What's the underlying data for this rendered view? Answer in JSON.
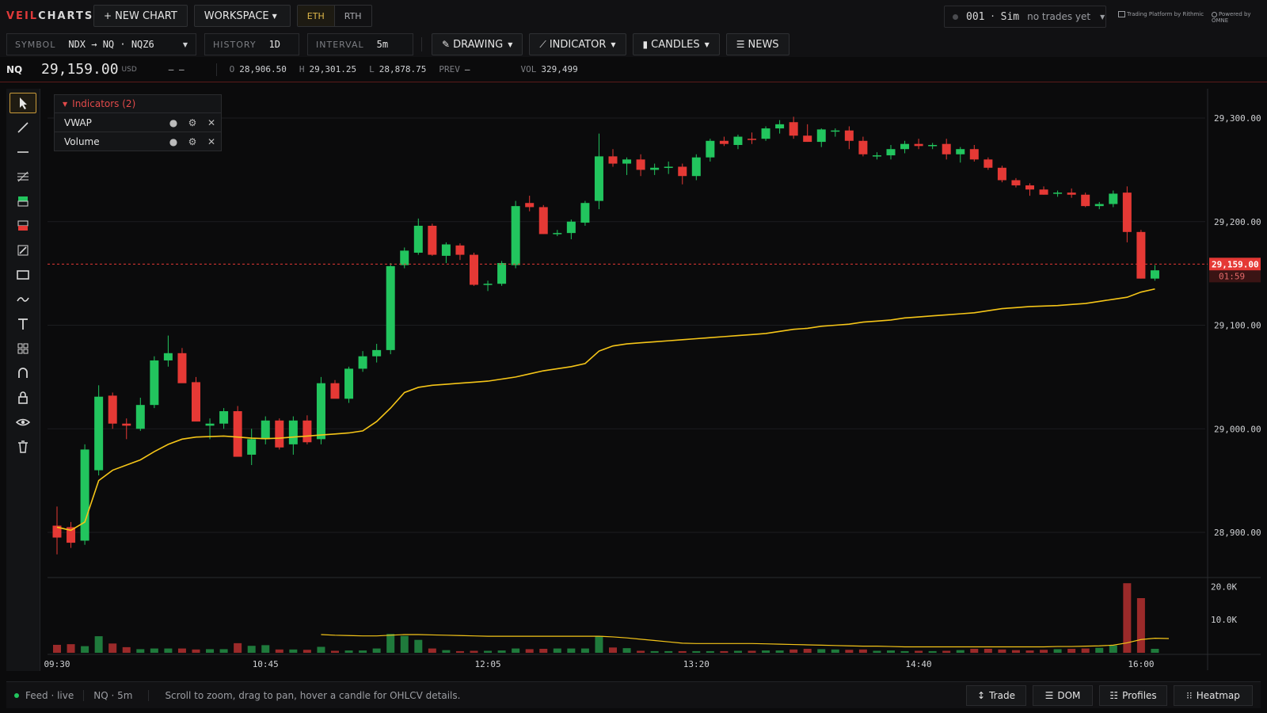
{
  "header": {
    "logo_a": "VEIL",
    "logo_b": "CHARTS",
    "new_chart": "NEW CHART",
    "workspace": "WORKSPACE",
    "session_eth": "ETH",
    "session_rth": "RTH",
    "account_id": "001",
    "account_sep": "·",
    "account_mode": "Sim",
    "account_status": "no trades yet",
    "platform_note": "Trading Platform by Rithmic",
    "powered_note": "Powered by OMNE"
  },
  "toolbar": {
    "symbol_label": "SYMBOL",
    "symbol_value": "NDX → NQ · NQZ6",
    "history_label": "HISTORY",
    "history_value": "1D",
    "interval_label": "INTERVAL",
    "interval_value": "5m",
    "drawing": "DRAWING",
    "indicator": "INDICATOR",
    "candles": "CANDLES",
    "news": "NEWS"
  },
  "quote": {
    "symbol": "NQ",
    "price": "29,159.00",
    "currency": "USD",
    "change": "– –",
    "o_label": "O",
    "o": "28,906.50",
    "h_label": "H",
    "h": "29,301.25",
    "l_label": "L",
    "l": "28,878.75",
    "prev_label": "PREV",
    "prev": "–",
    "vol_label": "VOL",
    "vol": "329,499"
  },
  "indicators": {
    "header": "Indicators (2)",
    "items": [
      {
        "name": "VWAP"
      },
      {
        "name": "Volume"
      }
    ]
  },
  "price_axis": {
    "ticks": [
      "29,300.00",
      "29,200.00",
      "29,100.00",
      "29,000.00",
      "28,900.00"
    ],
    "last_price": "29,159.00",
    "countdown": "01:59"
  },
  "volume_axis": {
    "ticks": [
      "20.0K",
      "10.0K"
    ]
  },
  "time_axis": {
    "ticks": [
      "09:30",
      "10:45",
      "12:05",
      "13:20",
      "14:40",
      "16:00"
    ]
  },
  "colors": {
    "up": "#22c55e",
    "down": "#e53935",
    "vwap": "#f5c518",
    "accent": "#e03a3a"
  },
  "statusbar": {
    "feed": "Feed · live",
    "chart": "NQ · 5m",
    "hint": "Scroll to zoom, drag to pan, hover a candle for OHLCV details.",
    "trade": "Trade",
    "dom": "DOM",
    "profiles": "Profiles",
    "heatmap": "Heatmap"
  },
  "chart_data": {
    "type": "candlestick",
    "x_start": "09:30",
    "interval_minutes": 5,
    "ylim": [
      28860,
      29320
    ],
    "volume_ylim": [
      0,
      22000
    ],
    "candles": [
      [
        28906.5,
        28925,
        28878.75,
        28895,
        2400
      ],
      [
        28905,
        28910,
        28885,
        28890,
        2600
      ],
      [
        28892,
        28985,
        28888,
        28980,
        2000
      ],
      [
        28960,
        29042,
        28955,
        29031,
        5000
      ],
      [
        29032,
        29035,
        29000,
        29005,
        2800
      ],
      [
        29005,
        29010,
        28990,
        29003,
        1700
      ],
      [
        29000,
        29030,
        28998,
        29023,
        1100
      ],
      [
        29023,
        29070,
        29020,
        29066,
        1300
      ],
      [
        29066,
        29090,
        29060,
        29073,
        1300
      ],
      [
        29073,
        29078,
        29045,
        29044,
        1300
      ],
      [
        29045,
        29050,
        29008,
        29007,
        1000
      ],
      [
        29003,
        29010,
        28990,
        29005,
        1100
      ],
      [
        29005,
        29020,
        29000,
        29017,
        1100
      ],
      [
        29017,
        29022,
        28980,
        28973,
        2900
      ],
      [
        28975,
        29000,
        28965,
        28990,
        2100
      ],
      [
        28990,
        29012,
        28985,
        29008,
        2300
      ],
      [
        29008,
        29010,
        28980,
        28982,
        1000
      ],
      [
        28985,
        29012,
        28975,
        29008,
        1000
      ],
      [
        29008,
        29013,
        28985,
        28987,
        900
      ],
      [
        28990,
        29050,
        28985,
        29044,
        1800
      ],
      [
        29044,
        29047,
        29030,
        29029,
        600
      ],
      [
        29029,
        29060,
        29025,
        29058,
        700
      ],
      [
        29058,
        29075,
        29055,
        29070,
        700
      ],
      [
        29070,
        29082,
        29064,
        29076,
        1300
      ],
      [
        29076,
        29160,
        29072,
        29157,
        5700
      ],
      [
        29158,
        29175,
        29155,
        29172,
        5100
      ],
      [
        29170,
        29203,
        29168,
        29196,
        3900
      ],
      [
        29196,
        29198,
        29167,
        29168,
        1300
      ],
      [
        29167,
        29180,
        29160,
        29178,
        800
      ],
      [
        29177,
        29179,
        29163,
        29168,
        500
      ],
      [
        29168,
        29170,
        29138,
        29139,
        600
      ],
      [
        29140,
        29143,
        29133,
        29140,
        600
      ],
      [
        29140,
        29162,
        29138,
        29160,
        700
      ],
      [
        29158,
        29220,
        29155,
        29215,
        1300
      ],
      [
        29218,
        29225,
        29210,
        29214,
        1100
      ],
      [
        29214,
        29216,
        29188,
        29188,
        1200
      ],
      [
        29189,
        29192,
        29186,
        29189,
        1300
      ],
      [
        29189,
        29202,
        29183,
        29200,
        1300
      ],
      [
        29199,
        29220,
        29196,
        29218,
        1300
      ],
      [
        29220,
        29285,
        29212,
        29263,
        5000
      ],
      [
        29263,
        29270,
        29253,
        29256,
        1600
      ],
      [
        29256,
        29262,
        29245,
        29260,
        1400
      ],
      [
        29260,
        29265,
        29244,
        29250,
        600
      ],
      [
        29250,
        29256,
        29245,
        29252,
        500
      ],
      [
        29252,
        29258,
        29246,
        29253,
        500
      ],
      [
        29253,
        29256,
        29236,
        29244,
        500
      ],
      [
        29244,
        29265,
        29240,
        29262,
        500
      ],
      [
        29262,
        29280,
        29258,
        29278,
        500
      ],
      [
        29278,
        29282,
        29273,
        29275,
        500
      ],
      [
        29274,
        29284,
        29270,
        29282,
        600
      ],
      [
        29280,
        29286,
        29275,
        29279,
        600
      ],
      [
        29280,
        29292,
        29278,
        29290,
        700
      ],
      [
        29290,
        29298,
        29285,
        29294,
        700
      ],
      [
        29296,
        29301.25,
        29280,
        29283,
        1000
      ],
      [
        29283,
        29294,
        29277,
        29277,
        1200
      ],
      [
        29277,
        29290,
        29272,
        29289,
        1100
      ],
      [
        29287,
        29290,
        29282,
        29288,
        1000
      ],
      [
        29288,
        29292,
        29270,
        29278,
        900
      ],
      [
        29278,
        29282,
        29263,
        29265,
        1000
      ],
      [
        29264,
        29267,
        29260,
        29264,
        600
      ],
      [
        29264,
        29274,
        29260,
        29270,
        700
      ],
      [
        29270,
        29278,
        29266,
        29275,
        500
      ],
      [
        29275,
        29280,
        29270,
        29273,
        600
      ],
      [
        29273,
        29276,
        29270,
        29274,
        500
      ],
      [
        29275,
        29280,
        29260,
        29265,
        600
      ],
      [
        29265,
        29272,
        29257,
        29270,
        800
      ],
      [
        29270,
        29274,
        29258,
        29260,
        1200
      ],
      [
        29260,
        29262,
        29250,
        29252,
        1200
      ],
      [
        29252,
        29254,
        29238,
        29240,
        1000
      ],
      [
        29240,
        29242,
        29233,
        29235,
        800
      ],
      [
        29235,
        29237,
        29225,
        29231,
        700
      ],
      [
        29231,
        29234,
        29226,
        29226,
        900
      ],
      [
        29227,
        29230,
        29224,
        29228,
        1100
      ],
      [
        29228,
        29232,
        29223,
        29226,
        1200
      ],
      [
        29226,
        29228,
        29214,
        29215,
        1300
      ],
      [
        29215,
        29219,
        29212,
        29217,
        1500
      ],
      [
        29217,
        29230,
        29214,
        29227,
        2200
      ],
      [
        29228,
        29234,
        29180,
        29190,
        21000
      ],
      [
        29190,
        29192,
        29145,
        29145,
        16500
      ],
      [
        29145,
        29158,
        29143,
        29153,
        1200
      ]
    ],
    "vwap": [
      [
        0,
        28905
      ],
      [
        1,
        28902
      ],
      [
        2,
        28910
      ],
      [
        3,
        28950
      ],
      [
        4,
        28960
      ],
      [
        5,
        28965
      ],
      [
        6,
        28970
      ],
      [
        7,
        28978
      ],
      [
        8,
        28985
      ],
      [
        9,
        28990
      ],
      [
        10,
        28992
      ],
      [
        11,
        28992.5
      ],
      [
        12,
        28993
      ],
      [
        13,
        28992
      ],
      [
        14,
        28991
      ],
      [
        15,
        28990.5
      ],
      [
        16,
        28991
      ],
      [
        17,
        28992
      ],
      [
        18,
        28993
      ],
      [
        19,
        28994
      ],
      [
        20,
        28995
      ],
      [
        21,
        28996
      ],
      [
        22,
        28998
      ],
      [
        23,
        29007
      ],
      [
        24,
        29020
      ],
      [
        25,
        29035
      ],
      [
        26,
        29040
      ],
      [
        27,
        29042
      ],
      [
        28,
        29043
      ],
      [
        29,
        29044
      ],
      [
        30,
        29045
      ],
      [
        31,
        29046
      ],
      [
        32,
        29048
      ],
      [
        33,
        29050
      ],
      [
        34,
        29053
      ],
      [
        35,
        29056
      ],
      [
        36,
        29058
      ],
      [
        37,
        29060
      ],
      [
        38,
        29063
      ],
      [
        39,
        29075
      ],
      [
        40,
        29080
      ],
      [
        41,
        29082
      ],
      [
        42,
        29083
      ],
      [
        43,
        29084
      ],
      [
        44,
        29085
      ],
      [
        45,
        29086
      ],
      [
        46,
        29087
      ],
      [
        47,
        29088
      ],
      [
        48,
        29089
      ],
      [
        49,
        29090
      ],
      [
        50,
        29091
      ],
      [
        51,
        29092
      ],
      [
        52,
        29094
      ],
      [
        53,
        29096
      ],
      [
        54,
        29097
      ],
      [
        55,
        29099
      ],
      [
        56,
        29100
      ],
      [
        57,
        29101
      ],
      [
        58,
        29103
      ],
      [
        59,
        29104
      ],
      [
        60,
        29105
      ],
      [
        61,
        29107
      ],
      [
        62,
        29108
      ],
      [
        63,
        29109
      ],
      [
        64,
        29110
      ],
      [
        65,
        29111
      ],
      [
        66,
        29112
      ],
      [
        67,
        29114
      ],
      [
        68,
        29116
      ],
      [
        69,
        29117
      ],
      [
        70,
        29118
      ],
      [
        71,
        29118.5
      ],
      [
        72,
        29119
      ],
      [
        73,
        29120
      ],
      [
        74,
        29121
      ],
      [
        75,
        29123
      ],
      [
        76,
        29125
      ],
      [
        77,
        29127
      ],
      [
        78,
        29132
      ],
      [
        79,
        29135
      ]
    ],
    "volume_ma": [
      [
        19,
        5500
      ],
      [
        20,
        5300
      ],
      [
        21,
        5200
      ],
      [
        22,
        5100
      ],
      [
        23,
        5100
      ],
      [
        24,
        5300
      ],
      [
        25,
        5500
      ],
      [
        26,
        5500
      ],
      [
        27,
        5400
      ],
      [
        28,
        5300
      ],
      [
        29,
        5200
      ],
      [
        30,
        5100
      ],
      [
        31,
        5000
      ],
      [
        32,
        5000
      ],
      [
        33,
        5000
      ],
      [
        34,
        5000
      ],
      [
        35,
        5000
      ],
      [
        36,
        5000
      ],
      [
        37,
        5000
      ],
      [
        38,
        5000
      ],
      [
        39,
        5000
      ],
      [
        40,
        4800
      ],
      [
        41,
        4500
      ],
      [
        42,
        4100
      ],
      [
        43,
        3700
      ],
      [
        44,
        3300
      ],
      [
        45,
        2900
      ],
      [
        46,
        2800
      ],
      [
        47,
        2800
      ],
      [
        48,
        2800
      ],
      [
        49,
        2800
      ],
      [
        50,
        2800
      ],
      [
        51,
        2700
      ],
      [
        52,
        2600
      ],
      [
        53,
        2500
      ],
      [
        54,
        2400
      ],
      [
        55,
        2300
      ],
      [
        56,
        2200
      ],
      [
        57,
        2100
      ],
      [
        58,
        2000
      ],
      [
        59,
        2000
      ],
      [
        60,
        1900
      ],
      [
        61,
        1800
      ],
      [
        62,
        1800
      ],
      [
        63,
        1800
      ],
      [
        64,
        1800
      ],
      [
        65,
        1800
      ],
      [
        66,
        1800
      ],
      [
        67,
        1800
      ],
      [
        68,
        1800
      ],
      [
        69,
        1800
      ],
      [
        70,
        1800
      ],
      [
        71,
        1800
      ],
      [
        72,
        1900
      ],
      [
        73,
        1900
      ],
      [
        74,
        2000
      ],
      [
        75,
        2100
      ],
      [
        76,
        2300
      ],
      [
        77,
        3000
      ],
      [
        78,
        4000
      ],
      [
        79,
        4400
      ],
      [
        80,
        4300
      ]
    ]
  }
}
